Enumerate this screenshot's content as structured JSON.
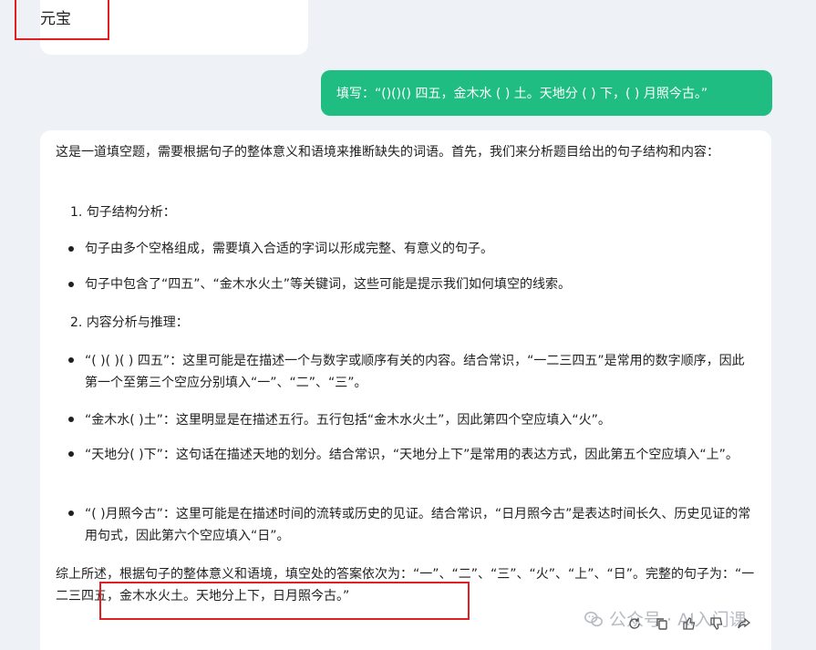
{
  "top_card": {
    "label": "元宝"
  },
  "user_message": "填写：“()()() 四五，金木水 ( ) 土。天地分 ( ) 下，( ) 月照今古。”",
  "answer": {
    "intro": "这是一道填空题，需要根据句子的整体意义和语境来推断缺失的词语。首先，我们来分析题目给出的句子结构和内容：",
    "section1_num": "1.",
    "section1_title": "句子结构分析：",
    "section1_bullets": [
      "句子由多个空格组成，需要填入合适的字词以形成完整、有意义的句子。",
      "句子中包含了“四五”、“金木水火土”等关键词，这些可能是提示我们如何填空的线索。"
    ],
    "section2_num": "2.",
    "section2_title": "内容分析与推理：",
    "section2_bullets": [
      "“( )( )( ) 四五”：这里可能是在描述一个与数字或顺序有关的内容。结合常识，“一二三四五”是常用的数字顺序，因此第一个至第三个空应分别填入“一”、“二”、“三”。",
      "“金木水( )土”：这里明显是在描述五行。五行包括“金木水火土”，因此第四个空应填入“火”。",
      "“天地分( )下”：这句话在描述天地的划分。结合常识，“天地分上下”是常用的表达方式，因此第五个空应填入“上”。",
      "“( )月照今古”：这里可能是在描述时间的流转或历史的见证。结合常识，“日月照今古”是表达时间长久、历史见证的常用句式，因此第六个空应填入“日”。"
    ],
    "conclusion": "综上所述，根据句子的整体意义和语境，填空处的答案依次为：“一”、“二”、“三”、“火”、“上”、“日”。完整的句子为：“一二三四五，金木水火土。天地分上下，日月照今古。”"
  },
  "watermark": "公众号 · AI入门课",
  "colors": {
    "accent": "#1fbd82",
    "highlight_box": "#e02020",
    "background": "#eef1f6"
  }
}
